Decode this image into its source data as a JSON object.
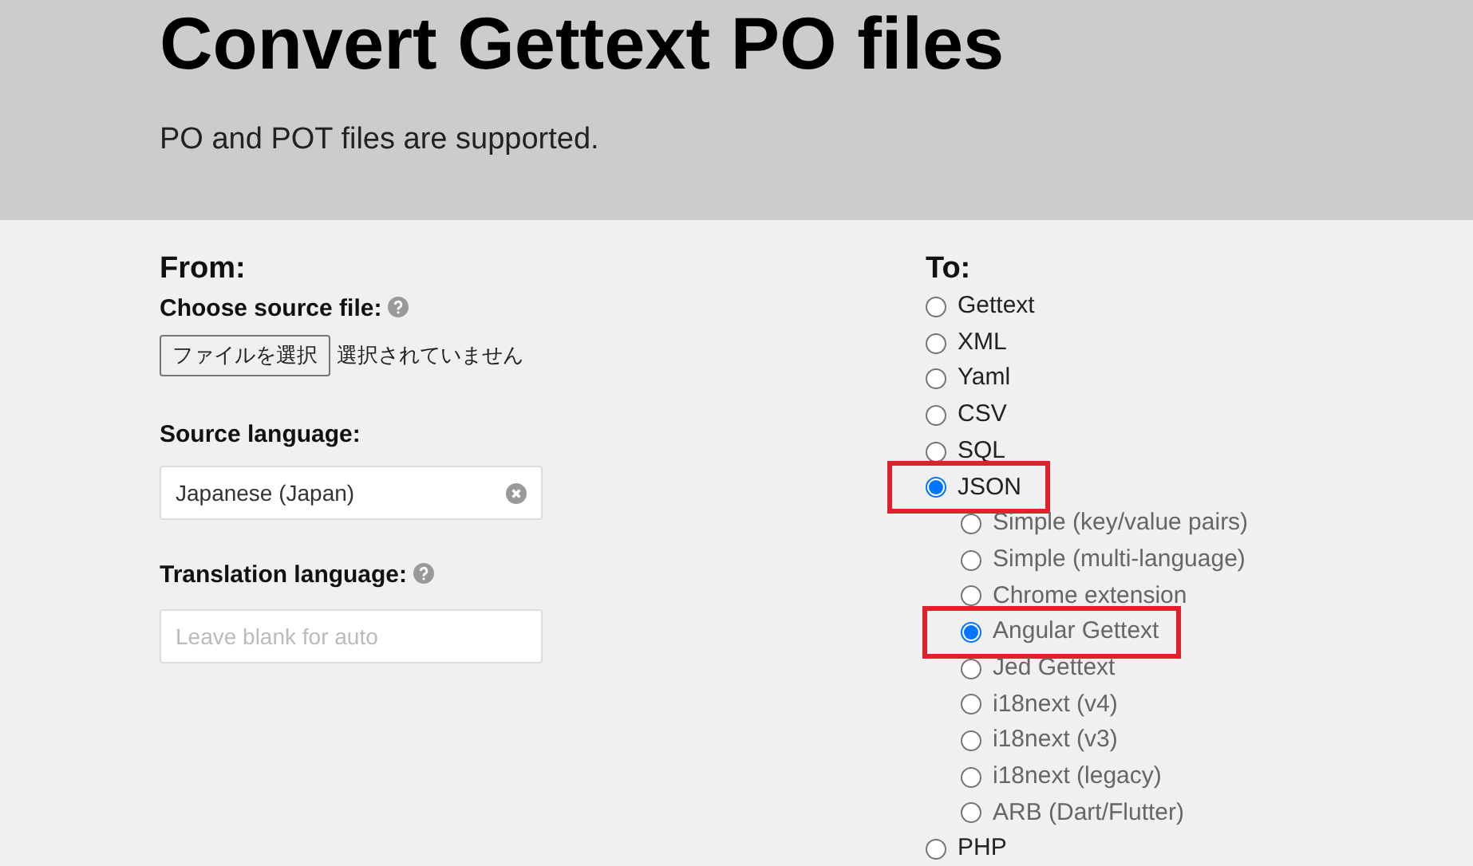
{
  "header": {
    "title": "Convert Gettext PO files",
    "subtitle": "PO and POT files are supported."
  },
  "from": {
    "heading": "From:",
    "file_label": "Choose source file:",
    "file_button": "ファイルを選択",
    "file_status": "選択されていません",
    "source_label": "Source language:",
    "source_value": "Japanese (Japan)",
    "translation_label": "Translation language:",
    "translation_placeholder": "Leave blank for auto"
  },
  "to": {
    "heading": "To:",
    "options": [
      {
        "label": "Gettext",
        "selected": false,
        "highlighted": false
      },
      {
        "label": "XML",
        "selected": false,
        "highlighted": false
      },
      {
        "label": "Yaml",
        "selected": false,
        "highlighted": false
      },
      {
        "label": "CSV",
        "selected": false,
        "highlighted": false
      },
      {
        "label": "SQL",
        "selected": false,
        "highlighted": false
      },
      {
        "label": "JSON",
        "selected": true,
        "highlighted": true,
        "children": [
          {
            "label": "Simple (key/value pairs)",
            "selected": false,
            "highlighted": false
          },
          {
            "label": "Simple (multi-language)",
            "selected": false,
            "highlighted": false
          },
          {
            "label": "Chrome extension",
            "selected": false,
            "highlighted": false
          },
          {
            "label": "Angular Gettext",
            "selected": true,
            "highlighted": true
          },
          {
            "label": "Jed Gettext",
            "selected": false,
            "highlighted": false
          },
          {
            "label": "i18next (v4)",
            "selected": false,
            "highlighted": false
          },
          {
            "label": "i18next (v3)",
            "selected": false,
            "highlighted": false
          },
          {
            "label": "i18next (legacy)",
            "selected": false,
            "highlighted": false
          },
          {
            "label": "ARB (Dart/Flutter)",
            "selected": false,
            "highlighted": false
          }
        ]
      },
      {
        "label": "PHP",
        "selected": false,
        "highlighted": false
      }
    ]
  }
}
